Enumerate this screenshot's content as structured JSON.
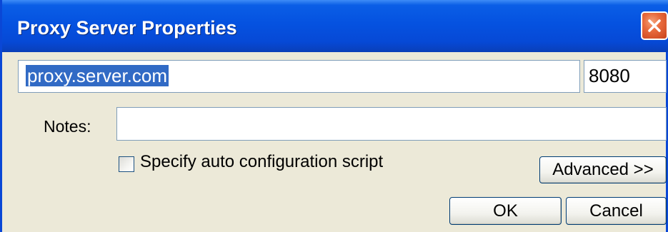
{
  "window": {
    "title": "Proxy Server Properties",
    "close_icon": "close-icon",
    "colors": {
      "titlebar": "#0552e0",
      "close_button": "#e86a3c",
      "dialog_bg": "#ece9d8",
      "selection": "#316ac5"
    }
  },
  "proxy": {
    "address_value": "proxy.server.com",
    "address_selected": true,
    "port_value": "8080"
  },
  "notes": {
    "label": "Notes:",
    "value": ""
  },
  "auto_config": {
    "label": "Specify auto configuration script",
    "checked": false
  },
  "buttons": {
    "advanced": "Advanced >>",
    "ok": "OK",
    "cancel": "Cancel"
  }
}
